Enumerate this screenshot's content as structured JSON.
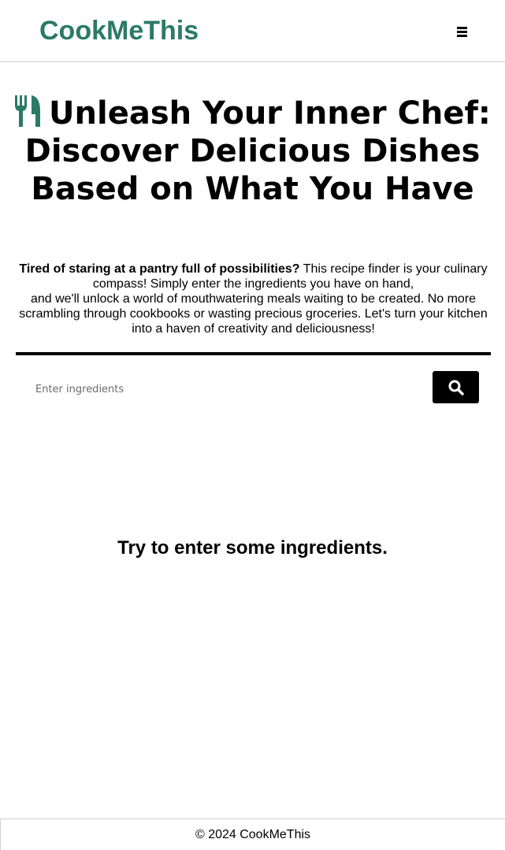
{
  "header": {
    "brand": "CookMeThis",
    "brand_color": "#2b7a66",
    "menu_icon": "hamburger-menu-icon"
  },
  "hero": {
    "icon": "fork-knife-icon",
    "title_line1": "Unleash Your Inner Chef:",
    "title_line2": "Discover Delicious Dishes Based on What You Have"
  },
  "intro": {
    "lead": "Tired of staring at a pantry full of possibilities?",
    "body1": " This recipe finder is your culinary compass! Simply enter the ingredients you have on hand,",
    "body2": "and we'll unlock a world of mouthwatering meals waiting to be created. No more scrambling through cookbooks or wasting precious groceries. Let's turn your kitchen into a haven of creativity and deliciousness!"
  },
  "search": {
    "placeholder": "Enter ingredients",
    "value": "",
    "button_icon": "search-icon"
  },
  "results": {
    "empty_message": "Try to enter some ingredients."
  },
  "footer": {
    "text": "© 2024 CookMeThis"
  }
}
